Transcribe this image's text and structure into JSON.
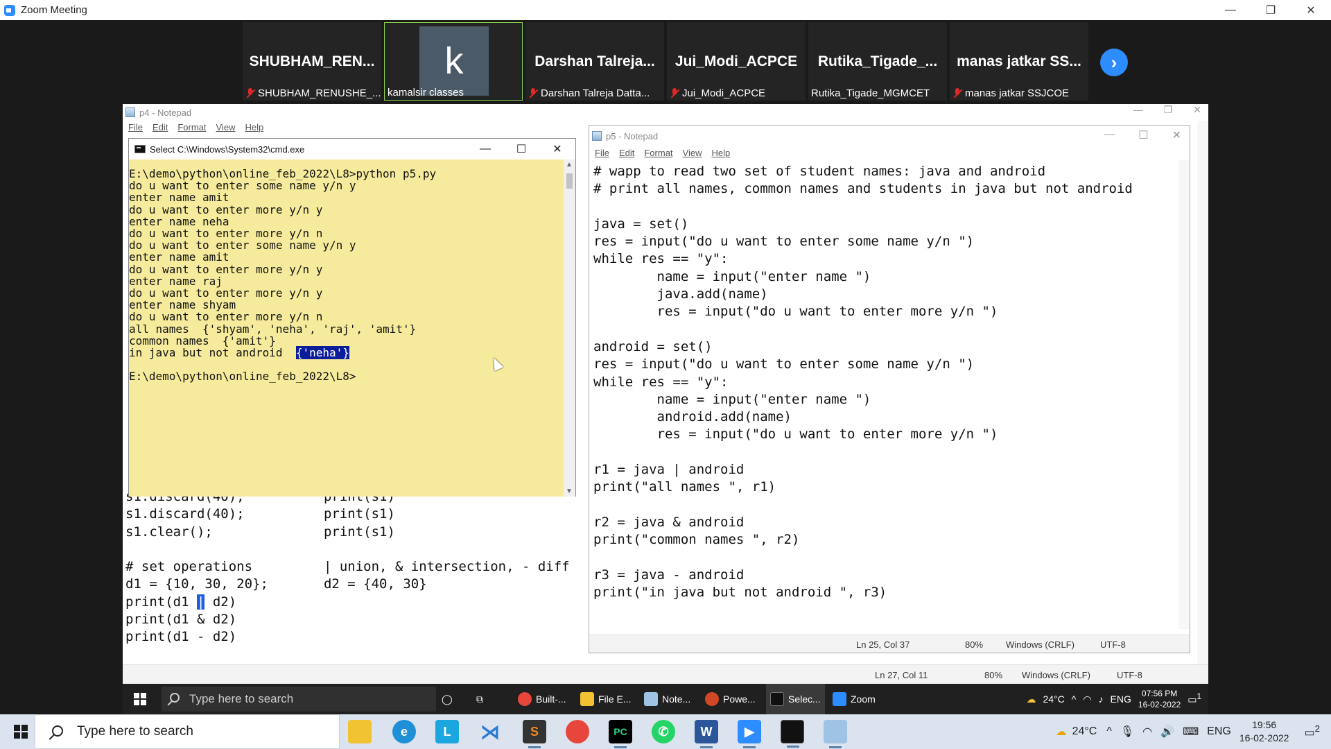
{
  "zoom": {
    "title": "Zoom Meeting",
    "controls": [
      "—",
      "❐",
      "✕"
    ]
  },
  "participants": [
    {
      "name": "SHUBHAM_REN...",
      "label": "SHUBHAM_RENUSHE_...",
      "muted": true
    },
    {
      "name": "k",
      "label": "kamalsir classes",
      "muted": false,
      "active": true
    },
    {
      "name": "Darshan  Talreja...",
      "label": "Darshan Talreja Datta...",
      "muted": true
    },
    {
      "name": "Jui_Modi_ACPCE",
      "label": "Jui_Modi_ACPCE",
      "muted": true
    },
    {
      "name": "Rutika_Tigade_...",
      "label": "Rutika_Tigade_MGMCET",
      "muted": false
    },
    {
      "name": "manas jatkar SS...",
      "label": "manas jatkar SSJCOE",
      "muted": true
    }
  ],
  "p4": {
    "title": "p4 - Notepad",
    "menu": [
      "File",
      "Edit",
      "Format",
      "View",
      "Help"
    ],
    "code_lines": [
      "s1.discard(40);          print(s1)",
      "s1.discard(40);          print(s1)",
      "s1.clear();              print(s1)",
      "",
      "# set operations         | union, & intersection, - diff",
      "d1 = {10, 30, 20};       d2 = {40, 30}",
      "print(d1 | d2)",
      "print(d1 & d2)",
      "print(d1 - d2)"
    ],
    "status": {
      "pos": "Ln 27, Col 11",
      "zoom": "80%",
      "eol": "Windows (CRLF)",
      "enc": "UTF-8"
    }
  },
  "cmd": {
    "title": "Select C:\\Windows\\System32\\cmd.exe",
    "lines": [
      "E:\\demo\\python\\online_feb_2022\\L8>python p5.py",
      "do u want to enter some name y/n y",
      "enter name amit",
      "do u want to enter more y/n y",
      "enter name neha",
      "do u want to enter more y/n n",
      "do u want to enter some name y/n y",
      "enter name amit",
      "do u want to enter more y/n y",
      "enter name raj",
      "do u want to enter more y/n y",
      "enter name shyam",
      "do u want to enter more y/n n",
      "all names  {'shyam', 'neha', 'raj', 'amit'}",
      "common names  {'amit'}"
    ],
    "last_prefix": "in java but not android  ",
    "last_selected": "{'neha'}",
    "blank": "",
    "prompt": "E:\\demo\\python\\online_feb_2022\\L8>"
  },
  "p5": {
    "title": "p5 - Notepad",
    "menu": [
      "File",
      "Edit",
      "Format",
      "View",
      "Help"
    ],
    "code_lines": [
      "# wapp to read two set of student names: java and android",
      "# print all names, common names and students in java but not android",
      "",
      "java = set()",
      "res = input(\"do u want to enter some name y/n \")",
      "while res == \"y\":",
      "        name = input(\"enter name \")",
      "        java.add(name)",
      "        res = input(\"do u want to enter more y/n \")",
      "",
      "android = set()",
      "res = input(\"do u want to enter some name y/n \")",
      "while res == \"y\":",
      "        name = input(\"enter name \")",
      "        android.add(name)",
      "        res = input(\"do u want to enter more y/n \")",
      "",
      "r1 = java | android",
      "print(\"all names \", r1)",
      "",
      "r2 = java & android",
      "print(\"common names \", r2)",
      "",
      "r3 = java - android",
      "print(\"in java but not android \", r3)"
    ],
    "status": {
      "pos": "Ln 25, Col 37",
      "zoom": "80%",
      "eol": "Windows (CRLF)",
      "enc": "UTF-8"
    }
  },
  "remote_taskbar": {
    "search_placeholder": "Type here to search",
    "apps": [
      "Built-...",
      "File E...",
      "Note...",
      "Powe...",
      "Selec...",
      "Zoom"
    ],
    "weather": "24°C",
    "lang": "ENG",
    "time": "07:56 PM",
    "date": "16-02-2022",
    "notif": "1"
  },
  "taskbar": {
    "search_placeholder": "Type here to search",
    "apps": [
      "file-explorer",
      "edge",
      "L",
      "vscode",
      "sublime",
      "chrome",
      "pycharm",
      "whatsapp",
      "word",
      "zoom",
      "cmd",
      "notepad"
    ],
    "weather": "24°C",
    "lang": "ENG",
    "time": "19:56",
    "date": "16-02-2022",
    "notif": "2"
  }
}
